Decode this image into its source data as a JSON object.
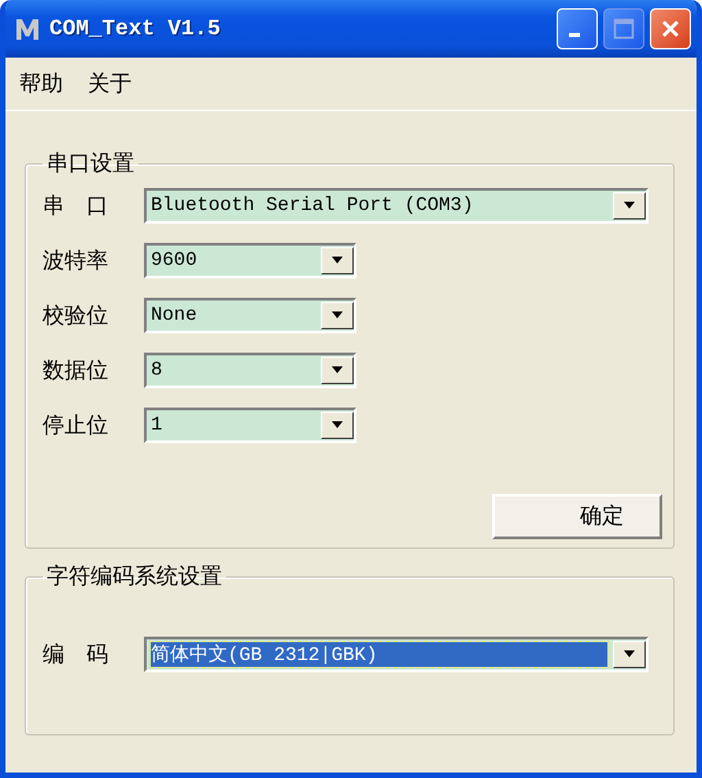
{
  "window": {
    "title": "COM_Text V1.5",
    "buttons": [
      {
        "kind": "minimize"
      },
      {
        "kind": "maximize"
      },
      {
        "kind": "close"
      }
    ]
  },
  "menu": [
    "帮助",
    "关于"
  ],
  "serial_group": {
    "title": "串口设置",
    "fields": [
      {
        "label": "串　口",
        "value": "Bluetooth Serial Port (COM3)",
        "wide": true
      },
      {
        "label": "波特率",
        "value": "9600",
        "wide": false
      },
      {
        "label": "校验位",
        "value": "None",
        "wide": false
      },
      {
        "label": "数据位",
        "value": "8",
        "wide": false
      },
      {
        "label": "停止位",
        "value": "1",
        "wide": false
      }
    ],
    "button": "确定"
  },
  "encoding_group": {
    "title": "字符编码系统设置",
    "label": "编　码",
    "value": "简体中文(GB 2312|GBK)",
    "focused": true
  }
}
